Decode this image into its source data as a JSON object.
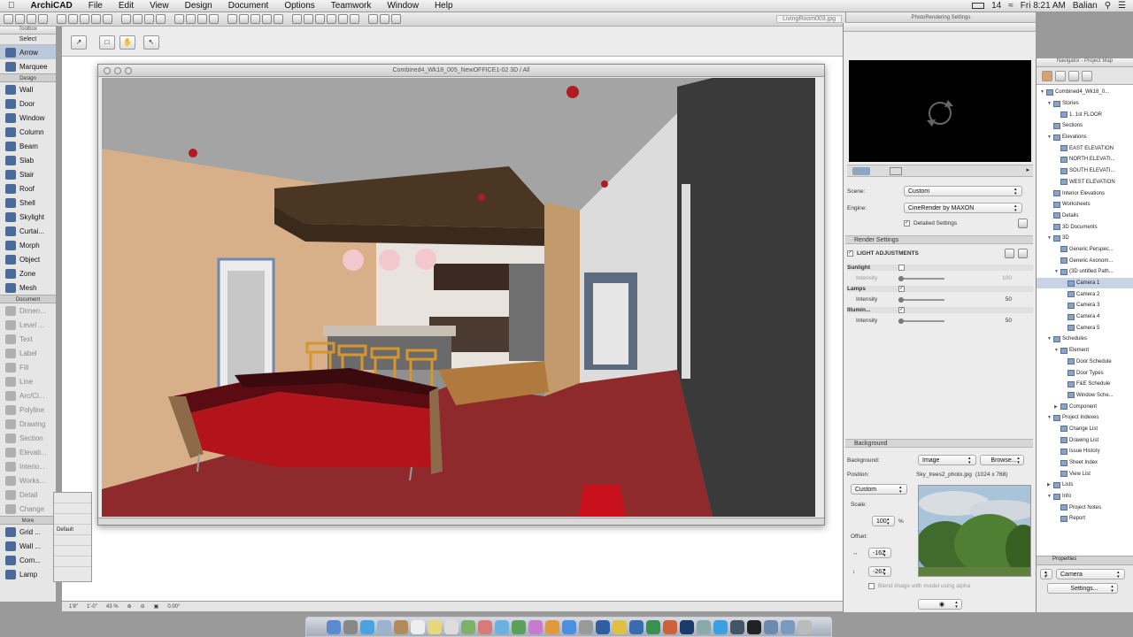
{
  "menubar": {
    "app": "ArchiCAD",
    "items": [
      "File",
      "Edit",
      "View",
      "Design",
      "Document",
      "Options",
      "Teamwork",
      "Window",
      "Help"
    ],
    "battery": "14",
    "clock": "Fri 8:21 AM",
    "user": "Balian"
  },
  "toolbar": {
    "doc_tab": "LivingRoom003.jpg",
    "render_tab": "PhotoRendering Settings"
  },
  "toolbox": {
    "title": "Toolbox",
    "select_label": "Select",
    "select_tools": [
      "Arrow",
      "Marquee"
    ],
    "design_group": "Design",
    "design_tools": [
      "Wall",
      "Door",
      "Window",
      "Column",
      "Beam",
      "Slab",
      "Stair",
      "Roof",
      "Shell",
      "Skylight",
      "Curtai...",
      "Morph",
      "Object",
      "Zone",
      "Mesh"
    ],
    "document_group": "Document",
    "document_tools": [
      "Dimen...",
      "Level ...",
      "Text",
      "Label",
      "Fill",
      "Line",
      "Arc/Ci...",
      "Polyline",
      "Drawing",
      "Section",
      "Elevati...",
      "Interio...",
      "Works...",
      "Detail",
      "Change"
    ],
    "more_group": "More",
    "more_tools": [
      "Grid ...",
      "Wall ...",
      "Corn...",
      "Lamp"
    ]
  },
  "floating_palette": {
    "label": "Default"
  },
  "view3d": {
    "title": "Combined4_Wk18_005_NewOFFICE1-02 3D / All"
  },
  "statusbar": {
    "scale1": "1'8\"",
    "scale2": "1'-0\"",
    "zoom": "43 %",
    "angle": "0.00°"
  },
  "render_settings": {
    "scene_label": "Scene:",
    "scene_value": "Custom",
    "engine_label": "Engine:",
    "engine_value": "CineRender by MAXON",
    "detailed_label": "Detailed Settings",
    "render_section": "Render Settings",
    "light_adjust": "LIGHT ADJUSTMENTS",
    "lights": [
      {
        "name": "Sunlight",
        "checked": false,
        "param": "Intensity",
        "value": "100"
      },
      {
        "name": "Lamps",
        "checked": true,
        "param": "Intensity",
        "value": "50"
      },
      {
        "name": "Illumin...",
        "checked": true,
        "param": "Intensity",
        "value": "50"
      }
    ],
    "background_section": "Background",
    "background_label": "Background:",
    "background_value": "Image",
    "browse_button": "Browse...",
    "position_label": "Position:",
    "position_value": "Custom",
    "filename": "Sky_trees2_photo.jpg",
    "filesize": "(1024 x 768)",
    "scale_label": "Scale:",
    "scale_value": "100",
    "scale_unit": "%",
    "offset_label": "Offset:",
    "offset_x": "-162",
    "offset_y": "-267",
    "blend_label": "Blend image with model using alpha"
  },
  "navigator": {
    "title": "Navigator - Project Map",
    "tree": [
      {
        "label": "Combined4_Wk18_0...",
        "level": 0,
        "tri": "▼"
      },
      {
        "label": "Stories",
        "level": 1,
        "tri": "▼"
      },
      {
        "label": "1. 1st FLOOR",
        "level": 2,
        "tri": ""
      },
      {
        "label": "Sections",
        "level": 1,
        "tri": ""
      },
      {
        "label": "Elevations",
        "level": 1,
        "tri": "▼"
      },
      {
        "label": "EAST ELEVATION",
        "level": 2,
        "tri": ""
      },
      {
        "label": "NORTH ELEVATI...",
        "level": 2,
        "tri": ""
      },
      {
        "label": "SOUTH ELEVATI...",
        "level": 2,
        "tri": ""
      },
      {
        "label": "WEST ELEVATION",
        "level": 2,
        "tri": ""
      },
      {
        "label": "Interior Elevations",
        "level": 1,
        "tri": ""
      },
      {
        "label": "Worksheets",
        "level": 1,
        "tri": ""
      },
      {
        "label": "Details",
        "level": 1,
        "tri": ""
      },
      {
        "label": "3D Documents",
        "level": 1,
        "tri": ""
      },
      {
        "label": "3D",
        "level": 1,
        "tri": "▼"
      },
      {
        "label": "Generic Perspec...",
        "level": 2,
        "tri": ""
      },
      {
        "label": "Generic Axonom...",
        "level": 2,
        "tri": ""
      },
      {
        "label": "(3D untitled Path...",
        "level": 2,
        "tri": "▼"
      },
      {
        "label": "Camera 1",
        "level": 3,
        "tri": "",
        "selected": true
      },
      {
        "label": "Camera 2",
        "level": 3,
        "tri": ""
      },
      {
        "label": "Camera 3",
        "level": 3,
        "tri": ""
      },
      {
        "label": "Camera 4",
        "level": 3,
        "tri": ""
      },
      {
        "label": "Camera 5",
        "level": 3,
        "tri": ""
      },
      {
        "label": "Schedules",
        "level": 1,
        "tri": "▼"
      },
      {
        "label": "Element",
        "level": 2,
        "tri": "▼"
      },
      {
        "label": "Door Schedule",
        "level": 3,
        "tri": ""
      },
      {
        "label": "Door Types",
        "level": 3,
        "tri": ""
      },
      {
        "label": "F&E Schedule",
        "level": 3,
        "tri": ""
      },
      {
        "label": "Window Sche...",
        "level": 3,
        "tri": ""
      },
      {
        "label": "Component",
        "level": 2,
        "tri": "▶"
      },
      {
        "label": "Project Indexes",
        "level": 1,
        "tri": "▼"
      },
      {
        "label": "Change List",
        "level": 2,
        "tri": ""
      },
      {
        "label": "Drawing List",
        "level": 2,
        "tri": ""
      },
      {
        "label": "Issue History",
        "level": 2,
        "tri": ""
      },
      {
        "label": "Sheet Index",
        "level": 2,
        "tri": ""
      },
      {
        "label": "View List",
        "level": 2,
        "tri": ""
      },
      {
        "label": "Lists",
        "level": 1,
        "tri": "▶"
      },
      {
        "label": "Info",
        "level": 1,
        "tri": "▼"
      },
      {
        "label": "Project Notes",
        "level": 2,
        "tri": ""
      },
      {
        "label": "Report",
        "level": 2,
        "tri": ""
      }
    ],
    "properties_label": "Properties",
    "camera_num": "1",
    "camera_name": "Camera",
    "settings_button": "Settings..."
  },
  "colors": {
    "wall_tan": "#d9b48d",
    "floor_red": "#8e2a2c",
    "sofa_red": "#b3141c",
    "ceiling_gray": "#9c9c9c",
    "panel_bg": "#ececec"
  }
}
